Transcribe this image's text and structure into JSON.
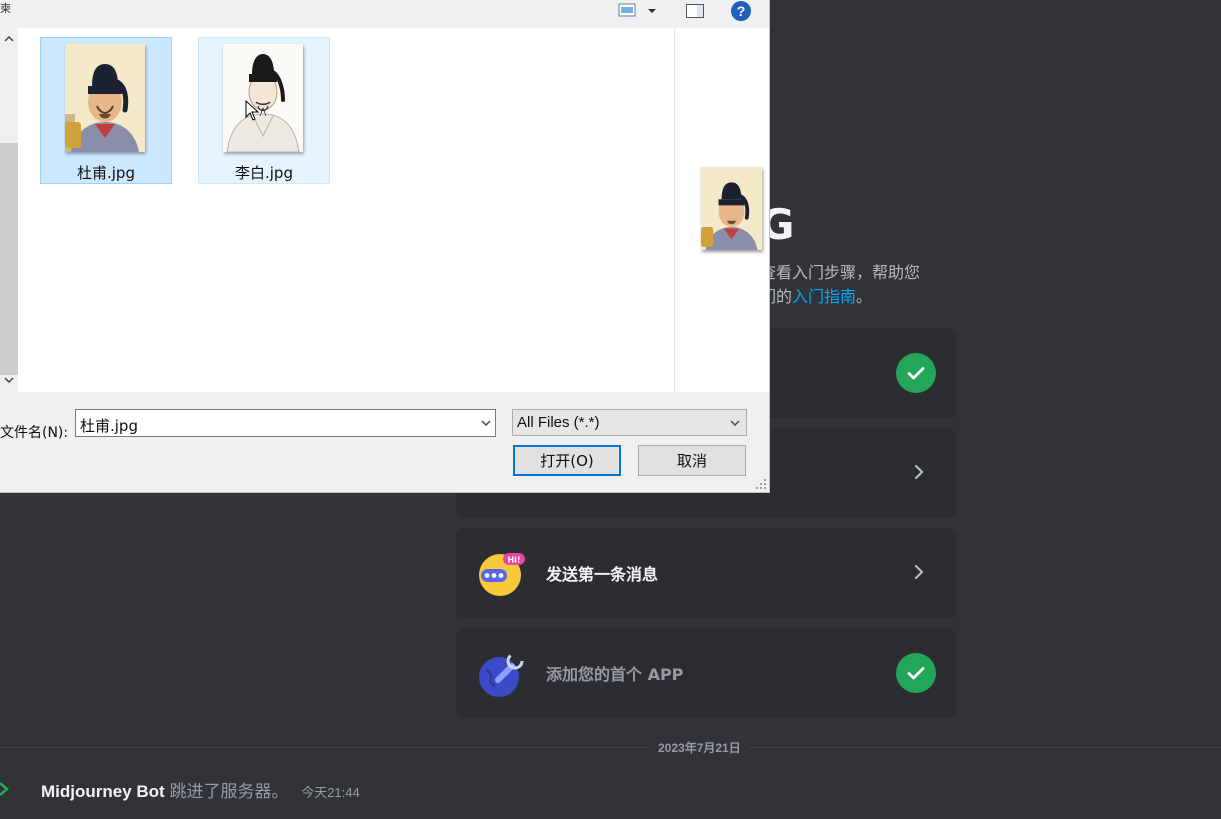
{
  "background": {
    "heading_partial_1": "'",
    "heading_partial_2": "G",
    "desc_line1": "查看入门步骤，帮助您",
    "desc_line2_prefix": "们的",
    "desc_link": "入门指南",
    "desc_line2_suffix": "。",
    "tasks": [
      {
        "label": "",
        "state": "done",
        "icon": "task-icon"
      },
      {
        "label": "",
        "state": "todo",
        "icon": "task-icon"
      },
      {
        "label": "发送第一条消息",
        "state": "todo",
        "icon": "chat-mascot-icon"
      },
      {
        "label": "添加您的首个 APP",
        "state": "done",
        "icon": "wrench-globe-icon"
      }
    ],
    "date_divider": "2023年7月21日",
    "message": {
      "user": "Midjourney Bot",
      "action": "跳进了服务器。",
      "time": "今天21:44"
    }
  },
  "dialog": {
    "titlebar_text": "柬",
    "files": [
      {
        "name": "杜甫.jpg",
        "state": "selected"
      },
      {
        "name": "李白.jpg",
        "state": "hover"
      }
    ],
    "filename_label": "文件名(N):",
    "filename_value": "杜甫.jpg",
    "filetype_value": "All Files (*.*)",
    "open_button": "打开(O)",
    "cancel_button": "取消"
  },
  "colors": {
    "discord_bg": "#313338",
    "card_bg": "#2b2d31",
    "success_green": "#23a55a",
    "link_blue": "#00a8fc",
    "selection_blue": "#cce8ff",
    "focus_blue": "#0078d7"
  }
}
